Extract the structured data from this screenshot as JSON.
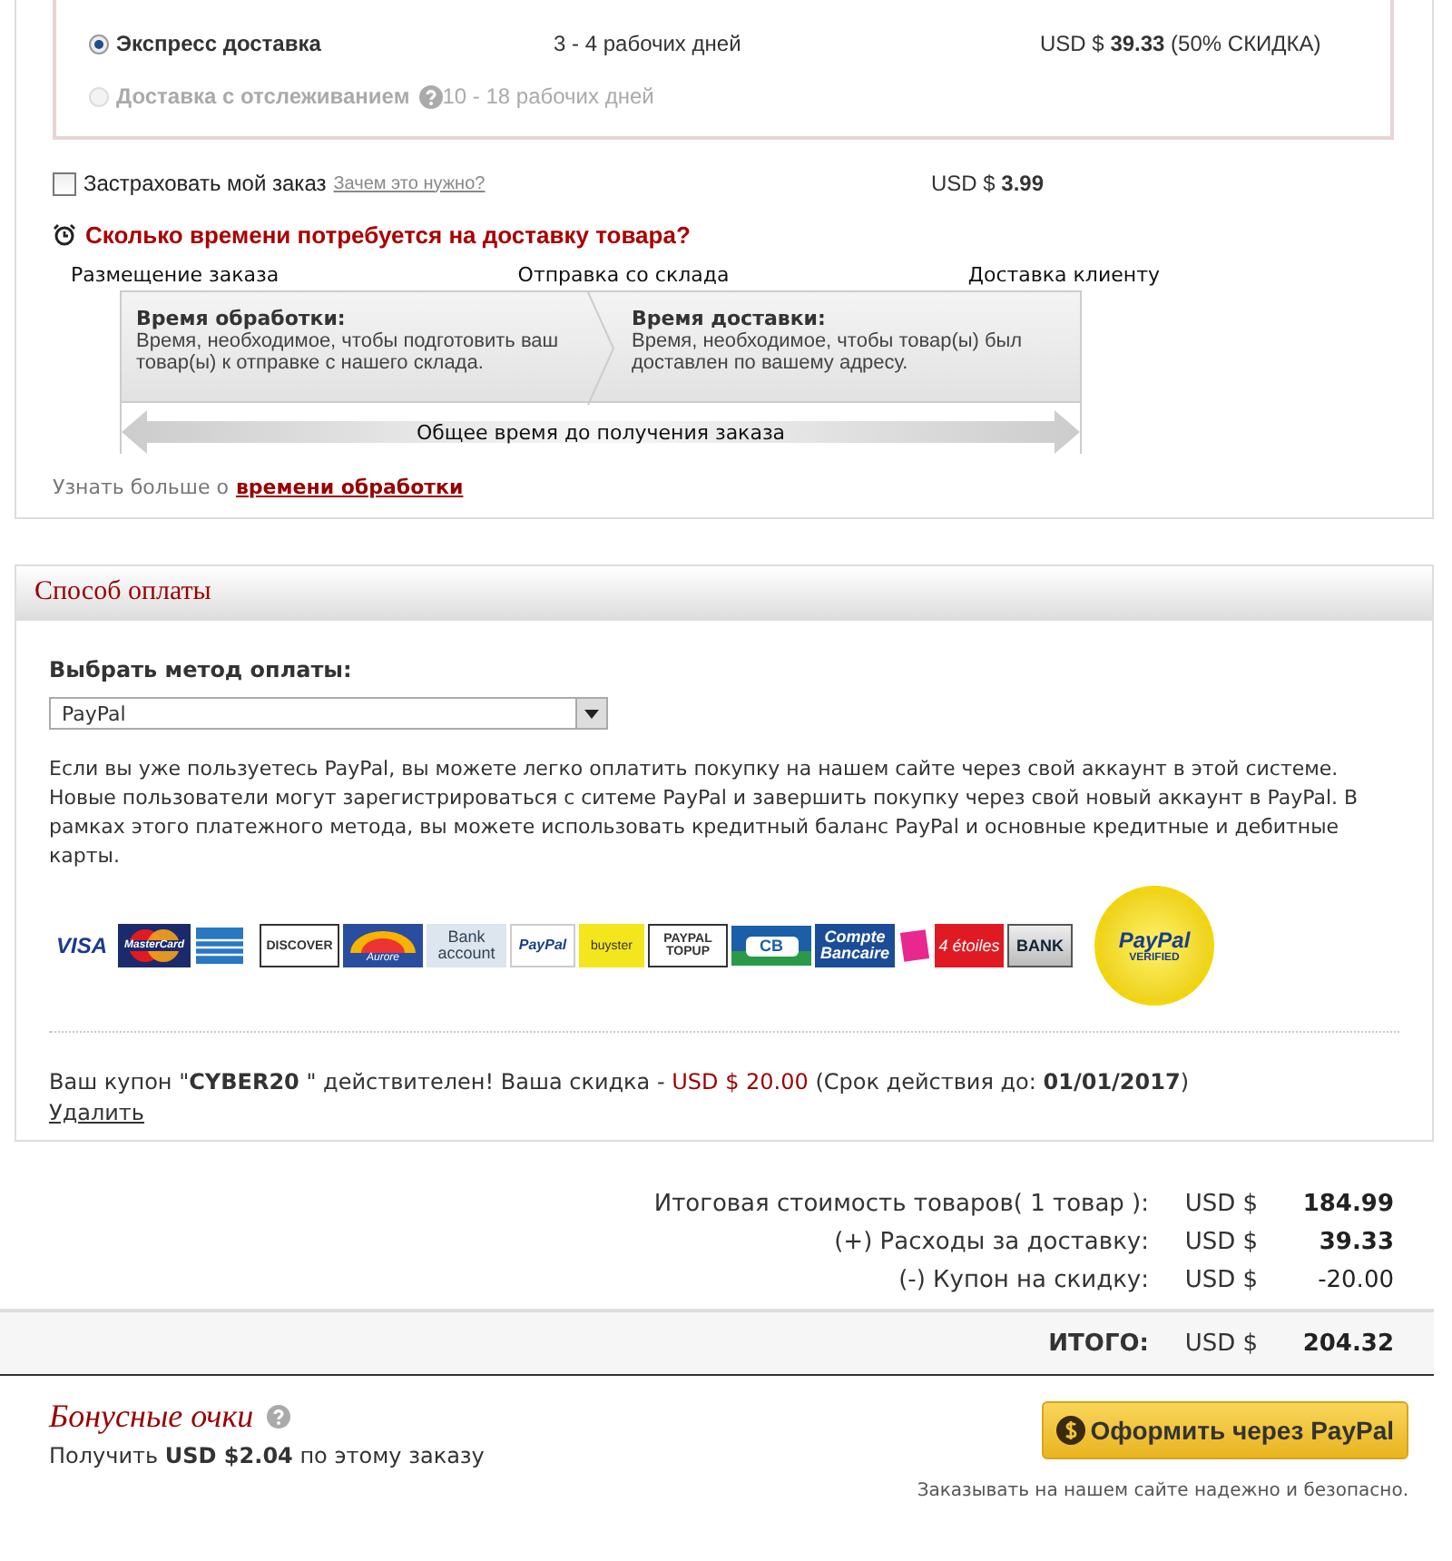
{
  "shipping": {
    "options": [
      {
        "name": "Экспресс доставка",
        "days": "3 - 4 рабочих дней",
        "price": "USD $ **39.33** (50% СКИДКА)",
        "selected": true,
        "disabled": false,
        "help": false
      },
      {
        "name": "Доставка с отслеживанием",
        "days": "10 - 18 рабочих дней",
        "selected": false,
        "disabled": true,
        "help": true
      }
    ],
    "insurance": {
      "label": "Застраховать мой заказ",
      "link": "Зачем это нужно?",
      "price": "USD $ **3.99**",
      "checked": false
    },
    "timeline": {
      "heading": "Сколько времени потребуется на доставку товара?",
      "milestones": [
        "Размещение заказа",
        "Отправка со склада",
        "Доставка клиенту"
      ],
      "stages": [
        {
          "title": "Время обработки:",
          "text": "Время, необходимое, чтобы подготовить ваш товар(ы) к отправке с нашего склада."
        },
        {
          "title": "Время доставки:",
          "text": "Время, необходимое, чтобы товар(ы) был доставлен по вашему адресу."
        }
      ],
      "total": "Общее время до получения заказа"
    },
    "learn_more": {
      "text": "Узнать больше о",
      "link": "времени обработки"
    }
  },
  "payment": {
    "title": "Способ оплаты",
    "method_label": "Выбрать метод оплаты:",
    "method_value": "PayPal",
    "description": "Если вы уже пользуетесь PayPal, вы можете легко оплатить покупку на нашем сайте через свой аккаунт в этой системе. Новые пользователи могут зарегистрироваться с ситеме PayPal и завершить покупку через свой новый аккаунт в PayPal. В рамках этого платежного метода, вы можете использовать кредитный баланс PayPal и основные кредитные и дебитные карты.",
    "logos": [
      {
        "label": "VISA",
        "kind": "plain"
      },
      {
        "label": "MasterCard",
        "kind": "circles"
      },
      {
        "kind": "amex"
      },
      {
        "label": "DISCOVER",
        "kind": "boxed"
      },
      {
        "label": "Aurore",
        "kind": "aurore"
      },
      {
        "label": "Bank account",
        "kind": "bank"
      },
      {
        "label": "PayPal",
        "kind": "paypal"
      },
      {
        "label": "buyster",
        "kind": "yellow"
      },
      {
        "label": "PAYPAL TOPUP",
        "kind": "boxed"
      },
      {
        "label": "CB",
        "kind": "cb"
      },
      {
        "label": "Compte Bancaire",
        "kind": "compte"
      },
      {
        "kind": "pink"
      },
      {
        "label": "4 étoiles",
        "kind": "red"
      },
      {
        "label": "BANK",
        "kind": "greybank"
      }
    ],
    "seal": {
      "brand": "PayPal",
      "caption": "VERIFIED"
    },
    "coupon": "Ваш купон \"**CYBER20** \" действителен! Ваша скидка - ",
    "coupon_amount": "USD $ 20.00",
    "coupon_expiry": "(Срок действия до: **01/01/2017**)",
    "remove": "Удалить"
  },
  "summary": {
    "rows": [
      {
        "label": "Итоговая стоимость товаров( 1 товар ):",
        "currency": "USD $",
        "amount": "184.99",
        "bold": true
      },
      {
        "label": "(+) Расходы за доставку:",
        "currency": "USD $",
        "amount": "39.33",
        "bold": true
      },
      {
        "label": "(-) Купон на скидку:",
        "currency": "USD $",
        "amount": "-20.00",
        "bold": false
      }
    ],
    "total": {
      "label": "ИТОГО:",
      "currency": "USD $",
      "amount": "204.32"
    }
  },
  "bonus": {
    "title": "Бонусные очки",
    "text": "Получить **USD $2.04** по этому заказу"
  },
  "checkout": {
    "button": "Оформить через PayPal",
    "note": "Заказывать на нашем сайте надежно и безопасно."
  }
}
